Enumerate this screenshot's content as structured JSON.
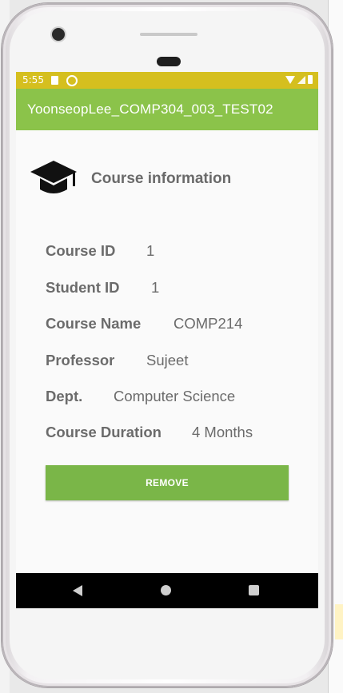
{
  "status_bar": {
    "time": "5:55"
  },
  "app_bar": {
    "title": "YoonseopLee_COMP304_003_TEST02"
  },
  "heading": "Course information",
  "fields": [
    {
      "label": "Course ID",
      "value": "1"
    },
    {
      "label": "Student ID",
      "value": "1"
    },
    {
      "label": "Course Name",
      "value": "COMP214"
    },
    {
      "label": "Professor",
      "value": "Sujeet"
    },
    {
      "label": "Dept.",
      "value": "Computer Science"
    },
    {
      "label": "Course Duration",
      "value": "4 Months"
    }
  ],
  "remove_button": "REMOVE",
  "icons": [
    "graduation-cap-icon",
    "sd-card-icon",
    "sync-icon",
    "wifi-icon",
    "signal-icon",
    "battery-icon",
    "back-icon",
    "home-icon",
    "recents-icon"
  ],
  "colors": {
    "status_bar": "#d5bf1f",
    "app_bar": "#8bc34a",
    "button": "#7ab648",
    "nav_bar": "#000000"
  }
}
